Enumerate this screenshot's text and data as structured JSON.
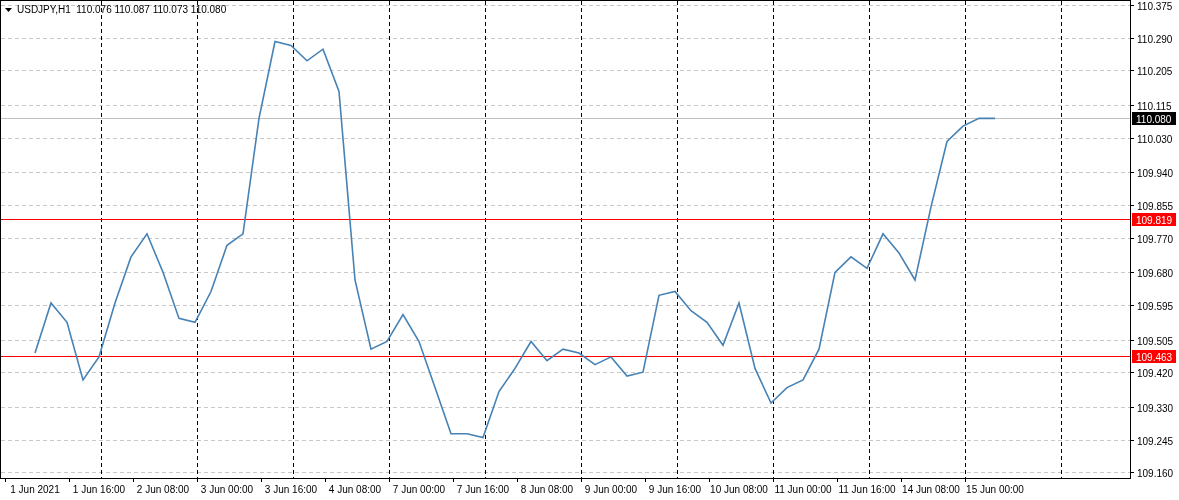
{
  "chart_data": {
    "type": "line",
    "title": "USDJPY,H1  110.076 110.087 110.073 110.080",
    "categories": [
      "1 Jun 2021",
      null,
      null,
      null,
      "1 Jun 16:00",
      null,
      null,
      null,
      "2 Jun 08:00",
      null,
      null,
      null,
      "3 Jun 00:00",
      null,
      null,
      null,
      "3 Jun 16:00",
      null,
      null,
      null,
      "4 Jun 08:00",
      null,
      null,
      null,
      "7 Jun 00:00",
      null,
      null,
      null,
      "7 Jun 16:00",
      null,
      null,
      null,
      "8 Jun 08:00",
      null,
      null,
      null,
      "9 Jun 00:00",
      null,
      null,
      null,
      "9 Jun 16:00",
      null,
      null,
      null,
      "10 Jun 08:00",
      null,
      null,
      null,
      "11 Jun 00:00",
      null,
      null,
      null,
      "11 Jun 16:00",
      null,
      null,
      null,
      "14 Jun 08:00",
      null,
      null,
      null,
      "15 Jun 00:00",
      null,
      null,
      null,
      null,
      null,
      null,
      null,
      null,
      null,
      null
    ],
    "series": [
      {
        "color": "#4682b4",
        "values": [
          109.47,
          109.6,
          109.55,
          109.4,
          109.46,
          109.6,
          109.72,
          109.78,
          109.68,
          109.56,
          109.55,
          109.63,
          109.75,
          109.78,
          110.08,
          110.28,
          110.27,
          110.23,
          110.26,
          110.15,
          109.66,
          109.48,
          109.5,
          109.57,
          109.5,
          109.38,
          109.26,
          109.26,
          109.25,
          109.37,
          109.43,
          109.5,
          109.45,
          109.48,
          109.47,
          109.44,
          109.46,
          109.41,
          109.42,
          109.62,
          109.63,
          109.58,
          109.55,
          109.49,
          109.6,
          109.43,
          109.34,
          109.38,
          109.4,
          109.48,
          109.68,
          109.72,
          109.69,
          109.78,
          109.73,
          109.66,
          109.85,
          110.02,
          110.06,
          110.08,
          110.08,
          null,
          null,
          null,
          null,
          null,
          null,
          null,
          null,
          null,
          null
        ]
      }
    ],
    "ylim": [
      109.145,
      110.388
    ],
    "grid": true,
    "ref_lines": [
      {
        "axis": "y",
        "value": 110.08,
        "label": "110.080",
        "color": "#c0c0c0"
      },
      {
        "axis": "y",
        "value": 109.819,
        "label": "109.819",
        "color": "#ff0000"
      },
      {
        "axis": "y",
        "value": 109.463,
        "label": "109.463",
        "color": "#ff0000"
      }
    ],
    "yticks": [
      {
        "value": 110.375,
        "label": "110.375"
      },
      {
        "value": 110.29,
        "label": "110.290"
      },
      {
        "value": 110.205,
        "label": "110.205"
      },
      {
        "value": 110.115,
        "label": "110.115"
      },
      {
        "value": 110.03,
        "label": "110.030"
      },
      {
        "value": 109.94,
        "label": "109.940"
      },
      {
        "value": 109.855,
        "label": "109.855"
      },
      {
        "value": 109.77,
        "label": "109.770"
      },
      {
        "value": 109.68,
        "label": "109.680"
      },
      {
        "value": 109.595,
        "label": "109.595"
      },
      {
        "value": 109.505,
        "label": "109.505"
      },
      {
        "value": 109.42,
        "label": "109.420"
      },
      {
        "value": 109.33,
        "label": "109.330"
      },
      {
        "value": 109.245,
        "label": "109.245"
      },
      {
        "value": 109.16,
        "label": "109.160"
      }
    ]
  }
}
